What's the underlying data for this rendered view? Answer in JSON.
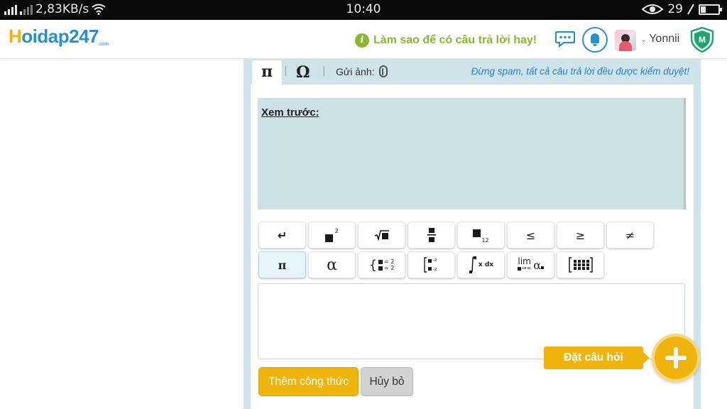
{
  "status_bar": {
    "network_speed": "2,83KB/s",
    "time": "10:40",
    "battery": "29",
    "battery_level_percent": 29
  },
  "header": {
    "logo_text": "Hoidap247",
    "logo_sub": ".com",
    "tip_text": "Làm sao để có câu trả lời hay!",
    "username": "Yonnii",
    "shield_letter": "M"
  },
  "editor": {
    "tab_pi": "π",
    "tab_omega": "Ω",
    "tab_separator": "|",
    "upload_label": "Gửi ảnh:",
    "notice": "Đừng spam, tất cả câu trả lời đều được kiểm duyệt!",
    "preview_label": "Xem trước:",
    "toolbar_row1": {
      "enter": "↵",
      "sup": "2",
      "le": "≤",
      "ge": "≥",
      "ne": "≠"
    },
    "toolbar_row2": {
      "pi": "π",
      "alpha": "α",
      "system_eq": "= 2",
      "integral": "x dx",
      "lim": "lim",
      "lim_sub": "→∞",
      "lim_alpha": "α"
    },
    "add_formula_button": "Thêm công thức",
    "cancel_button": "Hủy bỏ"
  },
  "fab": {
    "ask_label": "Đặt câu hỏi"
  },
  "colors": {
    "brand_blue": "#2b8fc9",
    "brand_yellow": "#f0b40f",
    "tip_green": "#8ab633",
    "panel_bg": "#cfe4ea"
  }
}
